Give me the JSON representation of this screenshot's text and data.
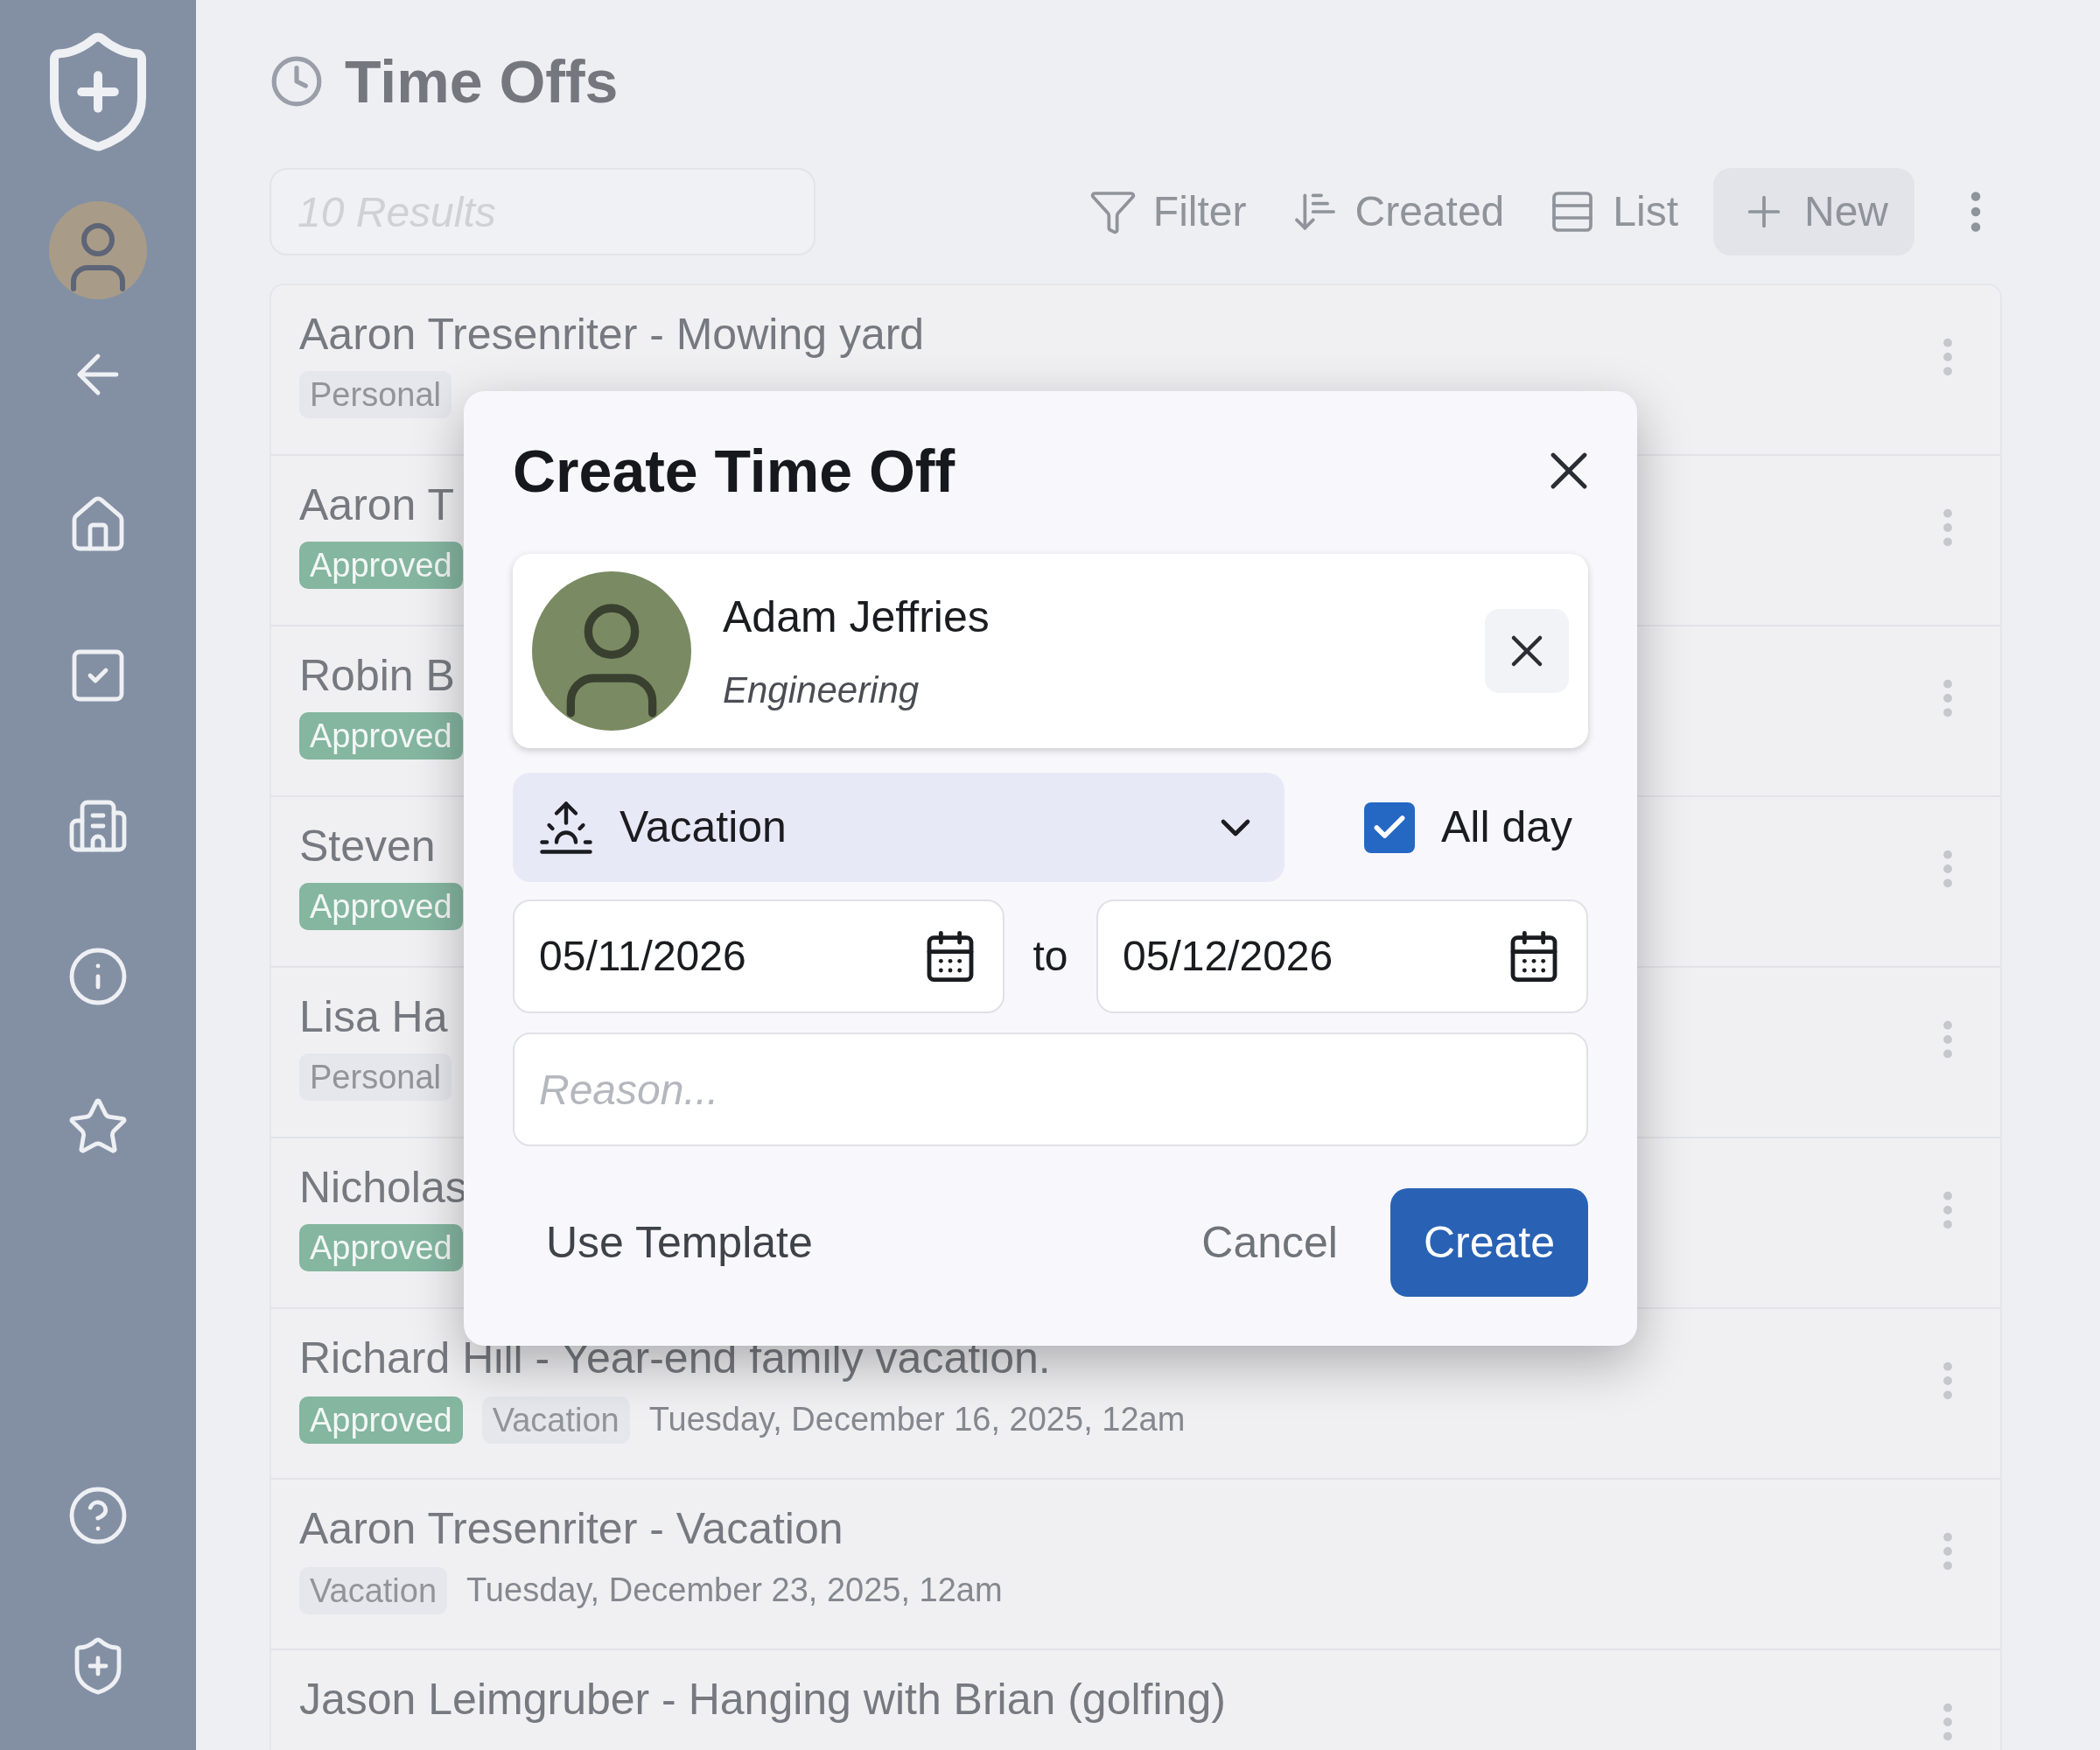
{
  "page": {
    "title": "Time Offs"
  },
  "search": {
    "placeholder": "10 Results"
  },
  "toolbar": {
    "filter": "Filter",
    "sort": "Created",
    "view": "List",
    "new": "New"
  },
  "rows": [
    {
      "title": "Aaron Tresenriter - Mowing yard",
      "badges": [
        {
          "text": "Personal",
          "kind": "category"
        }
      ]
    },
    {
      "title": "Aaron T",
      "badges": [
        {
          "text": "Approved",
          "kind": "status"
        }
      ]
    },
    {
      "title": "Robin B",
      "badges": [
        {
          "text": "Approved",
          "kind": "status"
        }
      ]
    },
    {
      "title": "Steven",
      "badges": [
        {
          "text": "Approved",
          "kind": "status"
        }
      ]
    },
    {
      "title": "Lisa Ha",
      "badges": [
        {
          "text": "Personal",
          "kind": "category"
        }
      ]
    },
    {
      "title": "Nicholas",
      "badges": [
        {
          "text": "Approved",
          "kind": "status"
        }
      ]
    },
    {
      "title": "Richard Hill - Year-end family vacation.",
      "badges": [
        {
          "text": "Approved",
          "kind": "status"
        },
        {
          "text": "Vacation",
          "kind": "category"
        }
      ],
      "date": "Tuesday, December 16, 2025, 12am"
    },
    {
      "title": "Aaron Tresenriter - Vacation",
      "badges": [
        {
          "text": "Vacation",
          "kind": "category"
        }
      ],
      "date": "Tuesday, December 23, 2025, 12am"
    },
    {
      "title": "Jason Leimgruber - Hanging with Brian (golfing)",
      "badges": []
    }
  ],
  "dialog": {
    "title": "Create Time Off",
    "employee": {
      "name": "Adam Jeffries",
      "department": "Engineering"
    },
    "type": {
      "value": "Vacation"
    },
    "all_day": {
      "label": "All day",
      "checked": true
    },
    "start_date": "05/11/2026",
    "separator": "to",
    "end_date": "05/12/2026",
    "reason": {
      "placeholder": "Reason..."
    },
    "buttons": {
      "template": "Use Template",
      "cancel": "Cancel",
      "create": "Create"
    }
  }
}
